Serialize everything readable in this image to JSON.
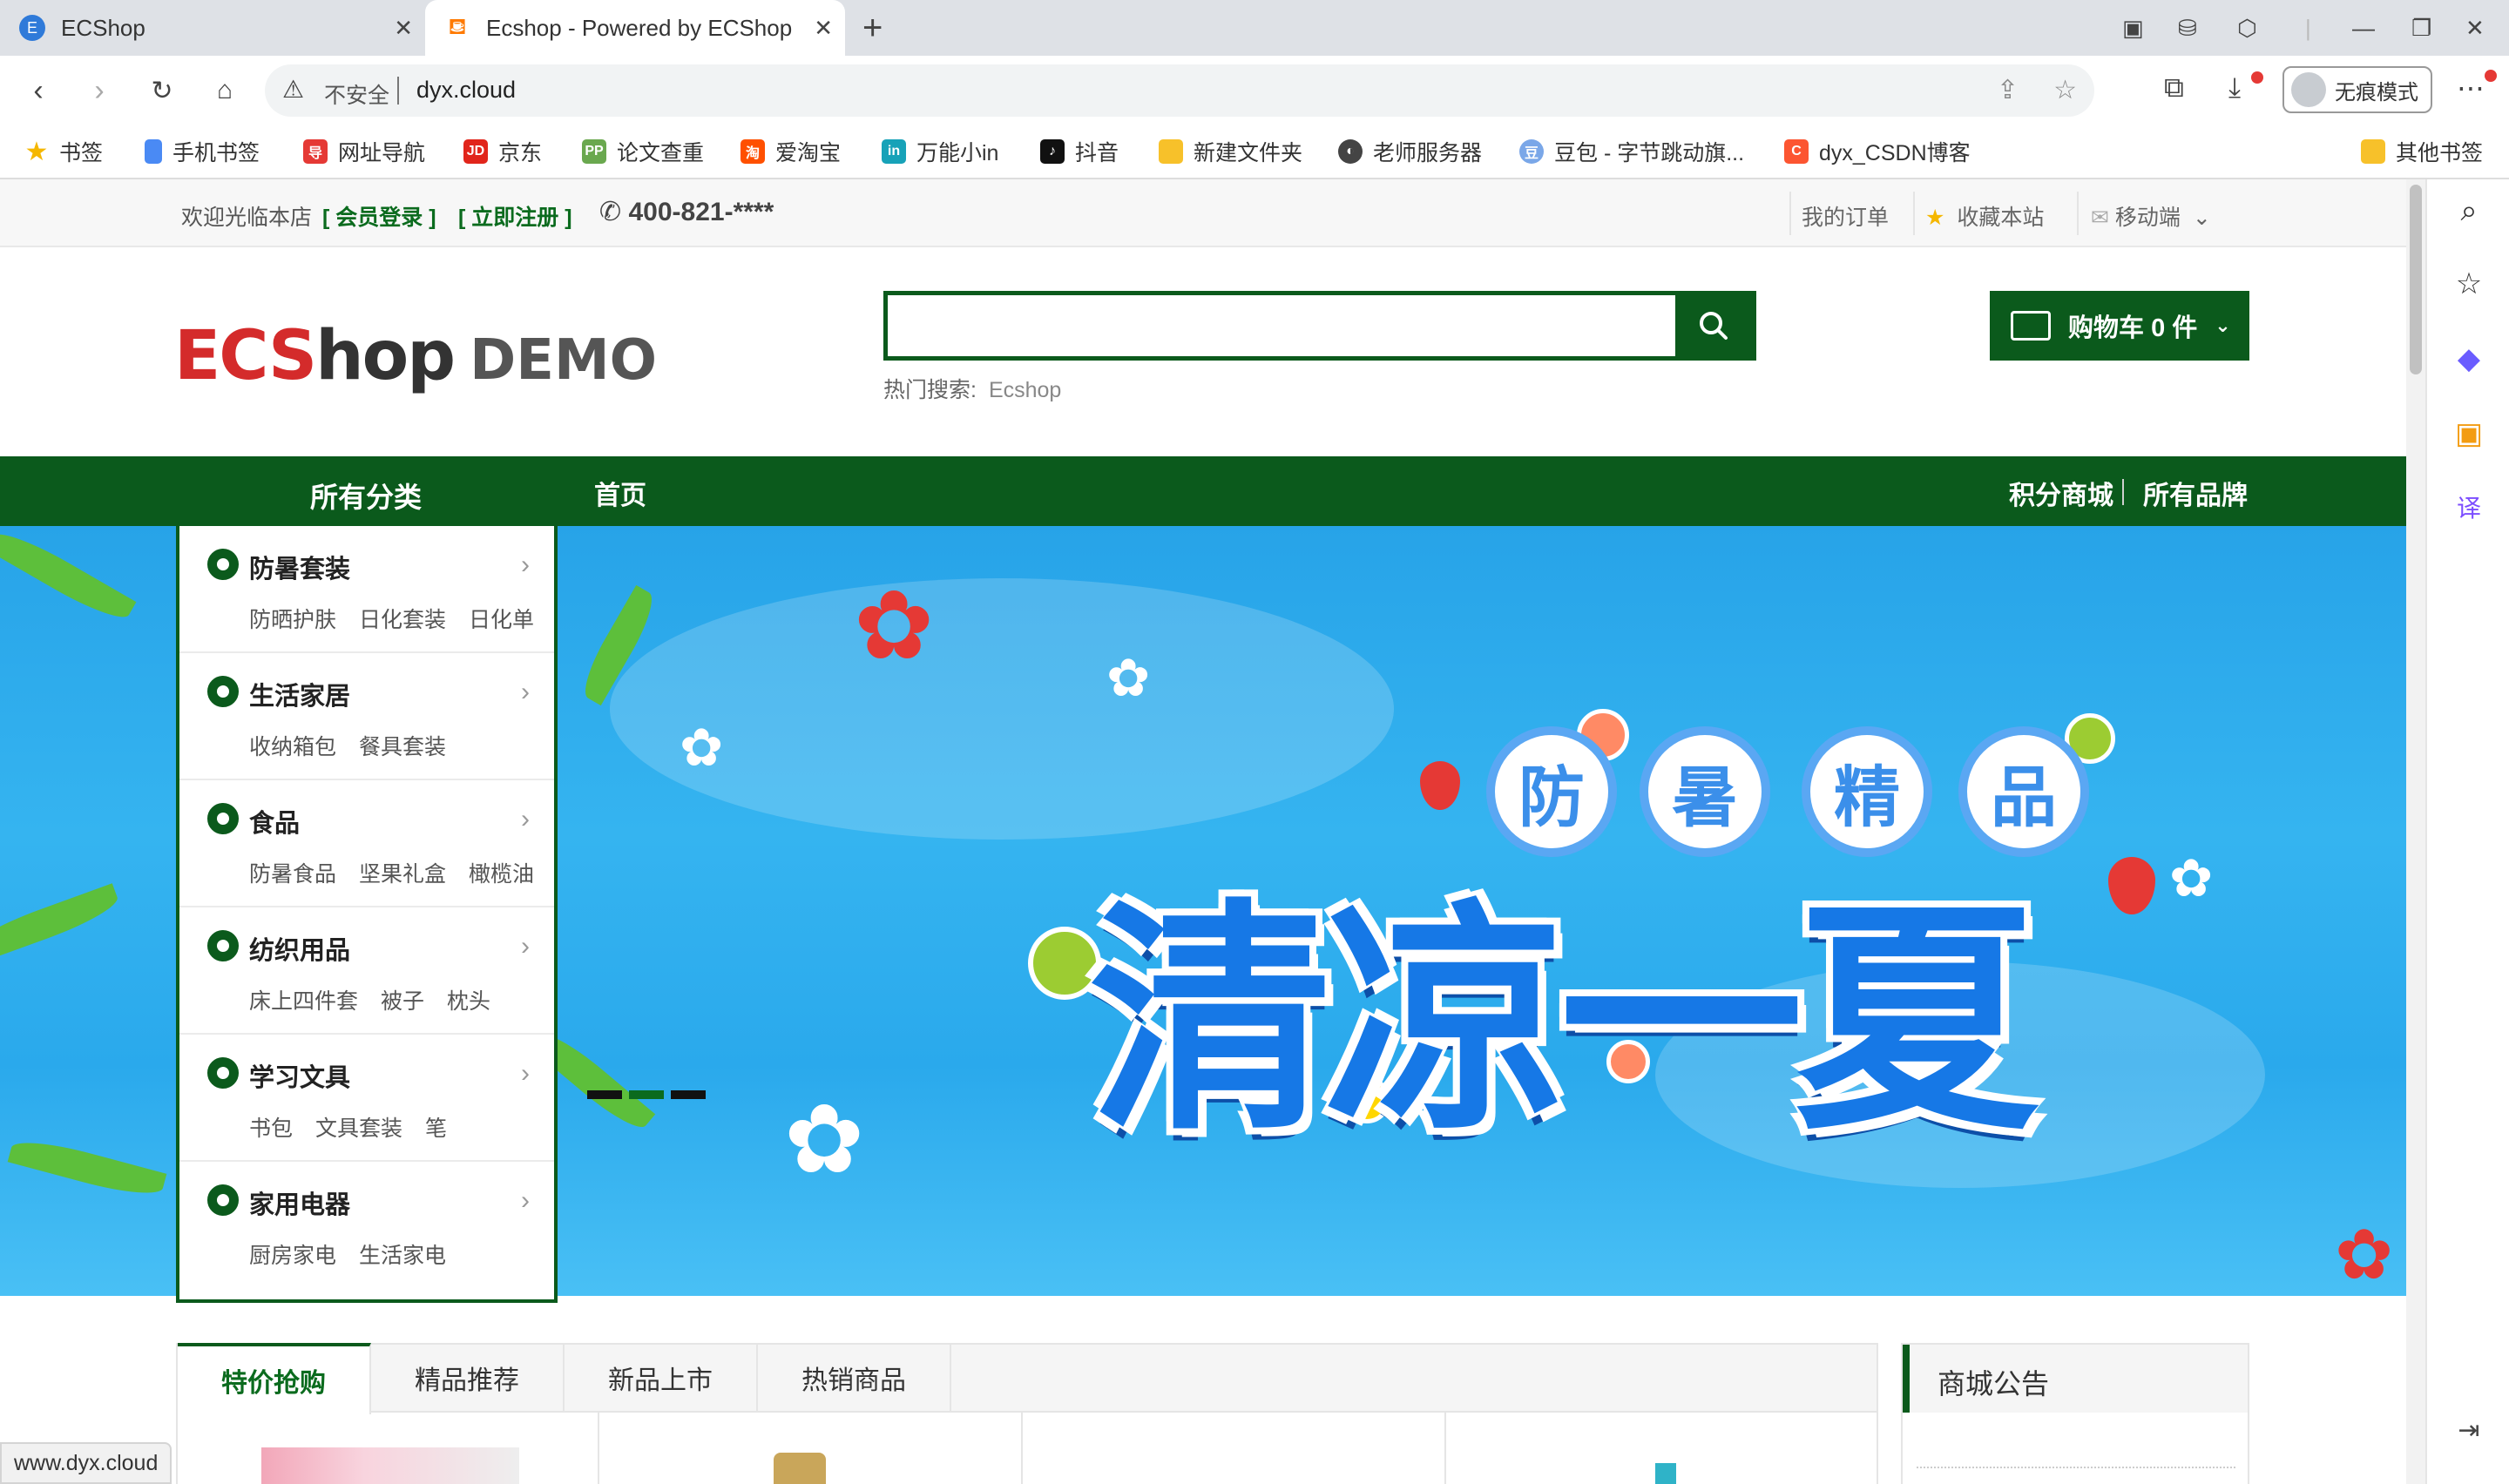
{
  "browser": {
    "tabs": [
      {
        "title": "ECShop",
        "favicon": "ecshop-favicon"
      },
      {
        "title": "Ecshop - Powered by ECShop",
        "favicon": "ecshop-favicon",
        "active": true
      }
    ],
    "omnibox": {
      "security": "不安全",
      "url": "dyx.cloud"
    },
    "incognito_label": "无痕模式",
    "bookmarks": [
      {
        "label": "书签",
        "icon": "star-icon",
        "color": "#f5b700"
      },
      {
        "label": "手机书签",
        "icon": "phone-icon",
        "color": "#4a8af4"
      },
      {
        "label": "网址导航",
        "icon": "nav-icon",
        "color": "#e53935"
      },
      {
        "label": "京东",
        "icon": "jd-icon",
        "color": "#e1251b"
      },
      {
        "label": "论文查重",
        "icon": "pp-icon",
        "color": "#6aa84f"
      },
      {
        "label": "爱淘宝",
        "icon": "taobao-icon",
        "color": "#ff5000"
      },
      {
        "label": "万能小in",
        "icon": "in-icon",
        "color": "#17a2b8"
      },
      {
        "label": "抖音",
        "icon": "tiktok-icon",
        "color": "#111111"
      },
      {
        "label": "新建文件夹",
        "icon": "folder-icon",
        "color": "#f7c12a"
      },
      {
        "label": "老师服务器",
        "icon": "server-icon",
        "color": "#444444"
      },
      {
        "label": "豆包 - 字节跳动旗...",
        "icon": "doubao-icon",
        "color": "#7aa7e8"
      },
      {
        "label": "dyx_CSDN博客",
        "icon": "csdn-icon",
        "color": "#fc5531"
      }
    ],
    "other_bookmarks": "其他书签",
    "status_url": "www.dyx.cloud"
  },
  "site": {
    "topbar": {
      "welcome": "欢迎光临本店",
      "login": "[ 会员登录 ]",
      "register": "[ 立即注册 ]",
      "phone": "400-821-****",
      "my_orders": "我的订单",
      "favorite": "收藏本站",
      "mobile": "移动端"
    },
    "logo": {
      "part1": "ECS",
      "part2": "hop",
      "demo": "DEMO"
    },
    "search": {
      "placeholder": "",
      "hot_label": "热门搜索:",
      "hot_keyword": "Ecshop"
    },
    "cart": {
      "label": "购物车",
      "count": "0 件"
    },
    "nav": {
      "all_categories": "所有分类",
      "home": "首页",
      "points_mall": "积分商城",
      "all_brands": "所有品牌"
    },
    "banner": {
      "headline": "清凉一夏",
      "bubbles": [
        "防",
        "暑",
        "精",
        "品"
      ]
    },
    "categories": [
      {
        "title": "防暑套装",
        "subs": [
          "防晒护肤",
          "日化套装",
          "日化单"
        ]
      },
      {
        "title": "生活家居",
        "subs": [
          "收纳箱包",
          "餐具套装"
        ]
      },
      {
        "title": "食品",
        "subs": [
          "防暑食品",
          "坚果礼盒",
          "橄榄油"
        ]
      },
      {
        "title": "纺织用品",
        "subs": [
          "床上四件套",
          "被子",
          "枕头"
        ]
      },
      {
        "title": "学习文具",
        "subs": [
          "书包",
          "文具套装",
          "笔"
        ]
      },
      {
        "title": "家用电器",
        "subs": [
          "厨房家电",
          "生活家电"
        ]
      }
    ],
    "product_tabs": [
      "特价抢购",
      "精品推荐",
      "新品上市",
      "热销商品"
    ],
    "notice_title": "商城公告"
  },
  "colors": {
    "primary": "#0b5a1c",
    "accent": "#0b6b1e",
    "banner_sky": "#2aa9ec"
  }
}
